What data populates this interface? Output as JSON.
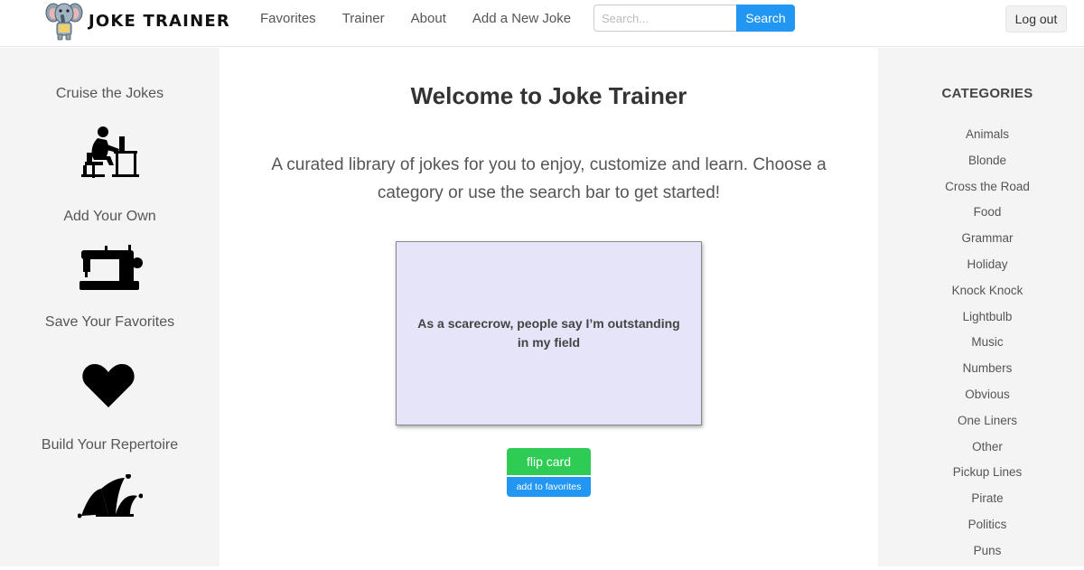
{
  "brand": {
    "name": "JOKE TRAINER",
    "logo": "elephant-logo"
  },
  "nav": {
    "links": [
      {
        "label": "Favorites"
      },
      {
        "label": "Trainer"
      },
      {
        "label": "About"
      },
      {
        "label": "Add a New Joke"
      }
    ],
    "search": {
      "placeholder": "Search...",
      "button_label": "Search"
    },
    "logout_label": "Log out"
  },
  "features": [
    {
      "label": "Cruise the Jokes",
      "icon": "person-at-computer-icon"
    },
    {
      "label": "Add Your Own",
      "icon": "sewing-machine-icon"
    },
    {
      "label": "Save Your Favorites",
      "icon": "heart-icon"
    },
    {
      "label": "Build Your Repertoire",
      "icon": "jester-hat-icon"
    }
  ],
  "main": {
    "title": "Welcome to Joke Trainer",
    "intro": "A curated library of jokes for you to enjoy, customize and learn. Choose a category or use the search bar to get started!",
    "card": {
      "text": "As a scarecrow, people say I’m outstanding in my field"
    },
    "flip_label": "flip card",
    "favorite_label": "add to favorites"
  },
  "categories": {
    "title": "CATEGORIES",
    "items": [
      "Animals",
      "Blonde",
      "Cross the Road",
      "Food",
      "Grammar",
      "Holiday",
      "Knock Knock",
      "Lightbulb",
      "Music",
      "Numbers",
      "Obvious",
      "One Liners",
      "Other",
      "Pickup Lines",
      "Pirate",
      "Politics",
      "Puns"
    ]
  },
  "colors": {
    "accent": "#2196f3",
    "flip_button": "#2ecc55",
    "card_background": "#e6e4f9",
    "panel_background": "#f4f4f4"
  }
}
